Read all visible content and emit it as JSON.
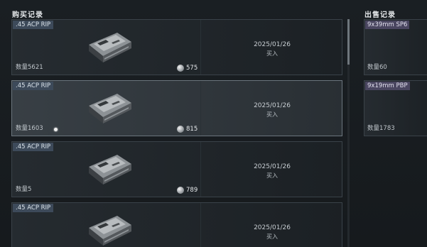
{
  "buy": {
    "title": "购买记录",
    "records": [
      {
        "item": ".45 ACP RIP",
        "quantity_label": "数量5621",
        "price": "575",
        "date": "2025/01/26",
        "action": "买入"
      },
      {
        "item": ".45 ACP RIP",
        "quantity_label": "数量1603",
        "price": "815",
        "date": "2025/01/26",
        "action": "买入"
      },
      {
        "item": ".45 ACP RIP",
        "quantity_label": "数量5",
        "price": "789",
        "date": "2025/01/26",
        "action": "买入"
      },
      {
        "item": ".45 ACP RIP",
        "quantity_label": "",
        "price": "",
        "date": "2025/01/26",
        "action": "买入"
      }
    ]
  },
  "sell": {
    "title": "出售记录",
    "records": [
      {
        "item": "9x39mm SP6",
        "quantity_label": "数量60"
      },
      {
        "item": "9x19mm PBP",
        "quantity_label": "数量1783"
      }
    ]
  },
  "colors": {
    "buy_tag": "#3d4a5a",
    "sell_tag": "#4a4660",
    "background": "#171b1f"
  },
  "icons": {
    "ammo": "ammo-box-icon",
    "currency": "coin-icon"
  }
}
